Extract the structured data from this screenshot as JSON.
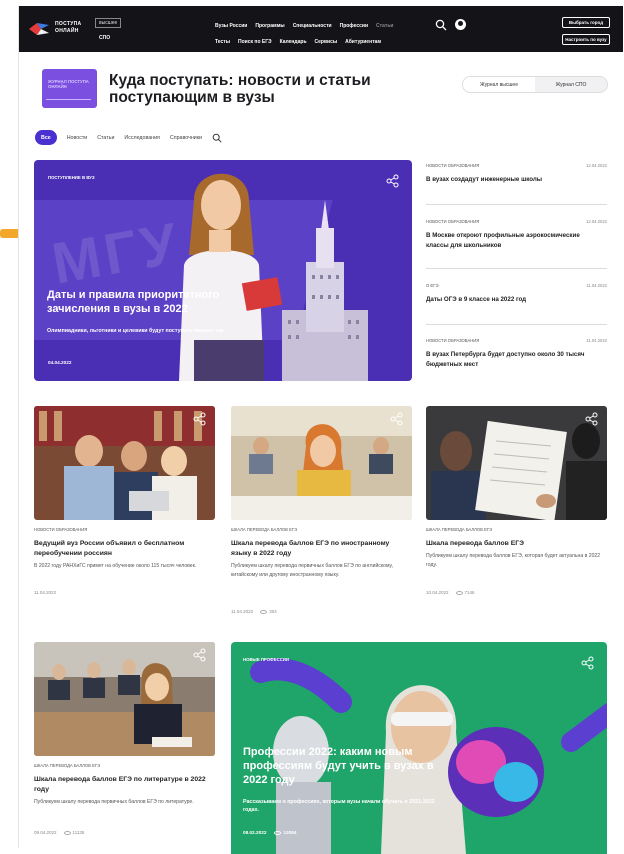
{
  "header": {
    "logo_text": "поступа онлайн",
    "level_selected": "высшее",
    "level_other": "СПО",
    "nav_row1": [
      "Вузы России",
      "Программы",
      "Специальности",
      "Профессии",
      "Статьи"
    ],
    "nav_row2": [
      "Тесты",
      "Поиск по ЕГЭ",
      "Календарь",
      "Сервисы",
      "Абитуриентам"
    ],
    "btn_city": "Выбрать город",
    "btn_setup": "Настроить по вузу"
  },
  "journal": {
    "logo_text": "журнал поступа онлайн",
    "title": "Куда поступать: новости и статьи поступающим в вузы",
    "tab_higher": "Журнал высшее",
    "tab_spo": "Журнал СПО"
  },
  "filters": [
    "Все",
    "Новости",
    "Статьи",
    "Исследования",
    "Справочники"
  ],
  "hero": {
    "kicker": "Поступление в вуз",
    "title": "Даты и правила приоритетного зачисления в вузы в 2022",
    "subtitle": "Олимпиадники, льготники и целевики будут поступать именно так.",
    "date": "04.04.2022",
    "watermark": "МГУ"
  },
  "side_news": [
    {
      "category": "Новости образования",
      "date": "12.04.2022",
      "title": "В вузах создадут инженерные школы"
    },
    {
      "category": "Новости образования",
      "date": "12.04.2022",
      "title": "В Москве откроют профильные аэрокосмические классы для школьников"
    },
    {
      "category": "О ЕГЭ",
      "date": "11.04.2022",
      "title": "Даты ОГЭ в 9 классе на 2022 год"
    },
    {
      "category": "Новости образования",
      "date": "11.04.2022",
      "title": "В вузах Петербурга будет доступно около 30 тысяч бюджетных мест"
    }
  ],
  "cards": [
    {
      "category": "Новости образования",
      "title": "Ведущий вуз России объявил о бесплатном переобучении россиян",
      "snippet": "В 2022 году РАНХиГС примет на обучение около 115 тысяч человек.",
      "date": "11.04.2022",
      "views": ""
    },
    {
      "category": "Шкала перевода баллов ЕГЭ",
      "title": "Шкала перевода баллов ЕГЭ по иностранному языку в 2022 году",
      "snippet": "Публикуем шкалу перевода первичных баллов ЕГЭ по английскому, китайскому или другому иностранному языку.",
      "date": "11.04.2022",
      "views": "304"
    },
    {
      "category": "Шкала перевода баллов ЕГЭ",
      "title": "Шкала перевода баллов ЕГЭ",
      "snippet": "Публикуем шкалу перевода баллов ЕГЭ, которая будет актуальна в 2022 году.",
      "date": "10.04.2022",
      "views": "7146"
    },
    {
      "category": "Шкала перевода баллов ЕГЭ",
      "title": "Шкала перевода баллов ЕГЭ по литературе в 2022 году",
      "snippet": "Публикуем шкалу перевода первичных баллов ЕГЭ по литературе.",
      "date": "09.04.2022",
      "views": "11135"
    }
  ],
  "feature": {
    "kicker": "Новые профессии",
    "title": "Профессии 2022: каким новым профессиям будут учить в вузах в 2022 году",
    "subtitle": "Рассказываем о профессиях, которым вузы начали обучать в 2021-2022 годах.",
    "date": "08.02.2022",
    "views": "12084"
  }
}
